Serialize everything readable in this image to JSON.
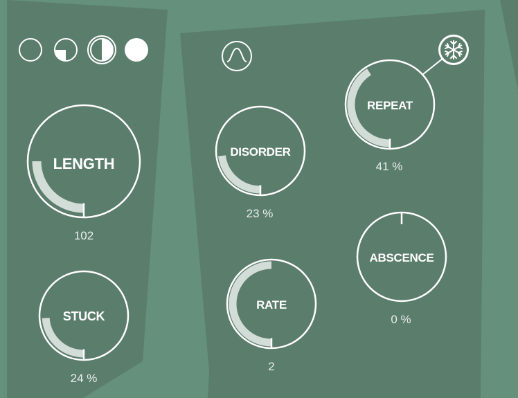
{
  "colors": {
    "background": "#64907c",
    "panel": "#5b7d6c",
    "stroke": "#ffffff",
    "arc": "#d3ddd8",
    "value_text": "#e7eeea"
  },
  "mode_selector": {
    "options": [
      "empty",
      "quarter",
      "half",
      "full"
    ],
    "selected": "half"
  },
  "icons": {
    "waveform": "sine-wave-icon",
    "freeze": "snowflake-icon"
  },
  "knobs": {
    "length": {
      "label": "LENGTH",
      "value_text": "102",
      "fill": 0.25
    },
    "stuck": {
      "label": "STUCK",
      "value_text": "24 %",
      "fill": 0.24
    },
    "disorder": {
      "label": "DISORDER",
      "value_text": "23 %",
      "fill": 0.23
    },
    "repeat": {
      "label": "REPEAT",
      "value_text": "41 %",
      "fill": 0.41
    },
    "rate": {
      "label": "RATE",
      "value_text": "2",
      "fill": 0.5
    },
    "absence": {
      "label": "ABSCENCE",
      "value_text": "0 %",
      "fill": 0.0
    }
  }
}
